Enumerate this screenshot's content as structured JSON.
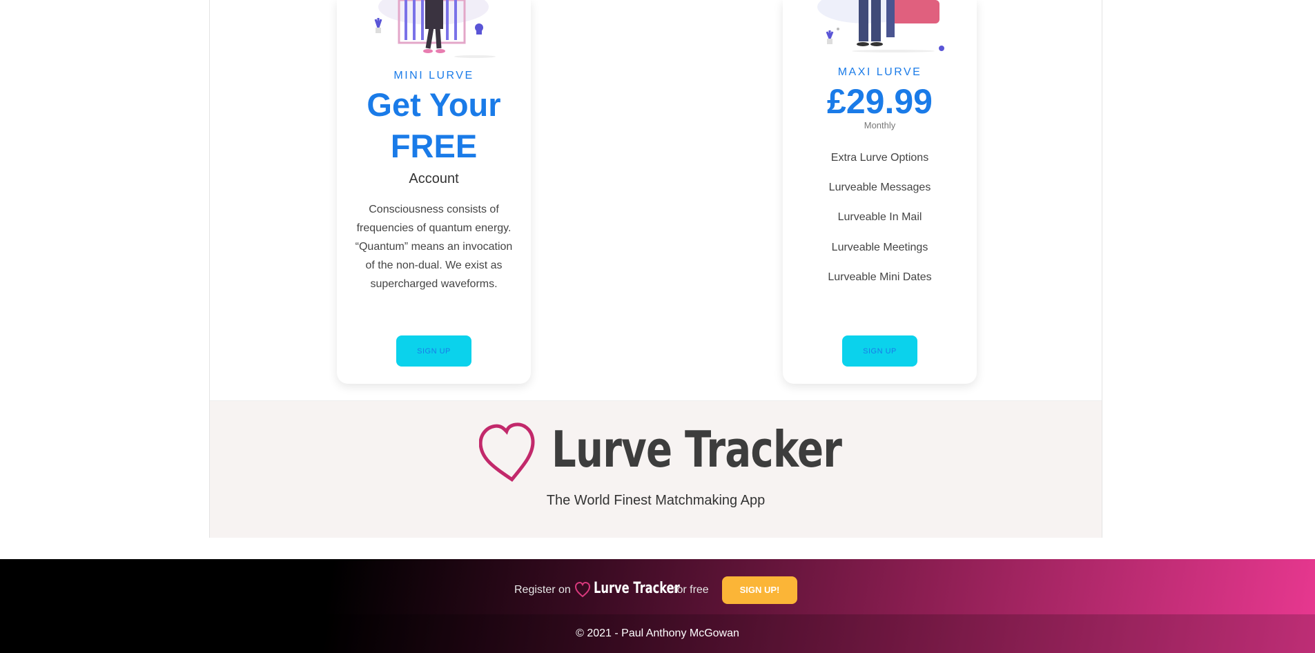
{
  "plans": {
    "mini": {
      "tier": "MINI LURVE",
      "headline_1": "Get Your",
      "headline_2": "FREE",
      "subheading": "Account",
      "description": "Consciousness consists of frequencies of quantum energy. “Quantum” means an invocation of the non-dual. We exist as supercharged waveforms.",
      "button": "SIGN UP"
    },
    "maxi": {
      "tier": "MAXI LURVE",
      "price": "£29.99",
      "period": "Monthly",
      "features": [
        "Extra Lurve Options",
        "Lurveable Messages",
        "Lurveable In Mail",
        "Lurveable Meetings",
        "Lurveable Mini Dates"
      ],
      "button": "SIGN UP"
    }
  },
  "brand": {
    "name": "Lurve Tracker",
    "tagline": "The World Finest Matchmaking App"
  },
  "footer": {
    "register_prefix": "Register on",
    "register_brand": "Lurve Tracker",
    "register_suffix": "for free",
    "signup": "SIGN UP!",
    "copyright": "© 2021 - Paul Anthony McGowan"
  },
  "colors": {
    "accent": "#1a7be8",
    "button": "#0bd2ec",
    "heart": "#c2296b",
    "footer_button": "#fbb537"
  }
}
